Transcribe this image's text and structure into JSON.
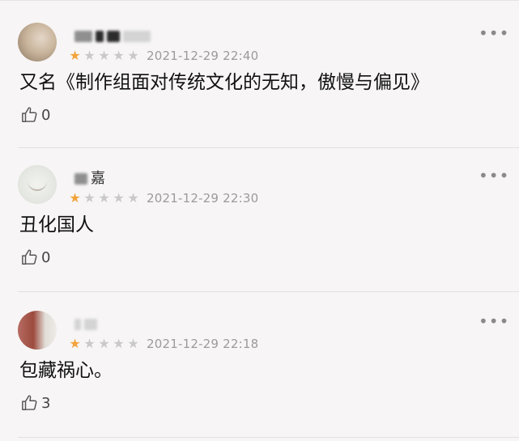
{
  "comments": [
    {
      "username_visible": "",
      "rating": 1,
      "max_rating": 5,
      "timestamp": "2021-12-29 22:40",
      "text": "又名《制作组面对传统文化的无知，傲慢与偏见》",
      "likes": "0",
      "more": "•••"
    },
    {
      "username_visible": "嘉",
      "rating": 1,
      "max_rating": 5,
      "timestamp": "2021-12-29 22:30",
      "text": "丑化国人",
      "likes": "0",
      "more": "•••"
    },
    {
      "username_visible": "",
      "rating": 1,
      "max_rating": 5,
      "timestamp": "2021-12-29 22:18",
      "text": "包藏祸心。",
      "likes": "3",
      "more": "•••"
    }
  ],
  "icons": {
    "like": "thumbs-up-icon",
    "more": "more-dots-icon",
    "star": "star-icon"
  },
  "colors": {
    "star_on": "#f2a33a",
    "star_off": "#c9c9c9",
    "timestamp": "#9b9b9b",
    "background": "#f7f5f5"
  }
}
